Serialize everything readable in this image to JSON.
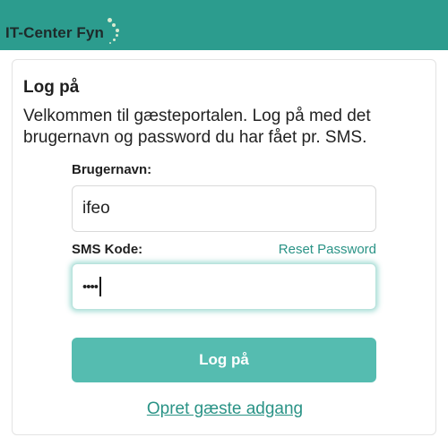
{
  "header": {
    "brand": "IT-Center Fyn",
    "background_color": "#2c9c8e"
  },
  "login": {
    "title": "Log på",
    "description": "Velkommen til gæsteportalen. Log på med det brugernavn og password du har fået pr. SMS.",
    "username_label": "Brugernavn:",
    "username_value": "ifeo",
    "sms_code_label": "SMS Kode:",
    "sms_code_masked": "••••",
    "reset_password_label": "Reset Password",
    "login_button_label": "Log på",
    "create_guest_access_label": "Opret gæste adgang",
    "accent_color": "#55bcb0",
    "link_color": "#2a9386"
  }
}
